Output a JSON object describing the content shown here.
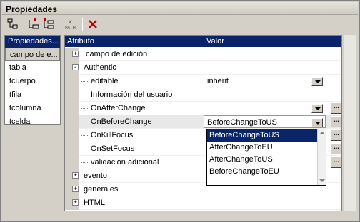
{
  "window": {
    "title": "Propiedades"
  },
  "left_panel": {
    "header": "Propiedades...",
    "items": [
      "campo de e...",
      "tabla",
      "tcuerpo",
      "tfila",
      "tcolumna",
      "tcelda"
    ],
    "selected": "campo de e..."
  },
  "grid": {
    "col_attribute": "Atributo",
    "col_value": "Valor",
    "rows": [
      {
        "name": "campo de edición",
        "expander": "+",
        "value": ""
      },
      {
        "name": "Authentic",
        "expander": "-",
        "value": ""
      },
      {
        "name": "editable",
        "value": "inherit"
      },
      {
        "name": "Información del usuario",
        "value": ""
      },
      {
        "name": "OnAfterChange",
        "value": ""
      },
      {
        "name": "OnBeforeChange",
        "value": "BeforeChangeToUS"
      },
      {
        "name": "OnKillFocus",
        "value": ""
      },
      {
        "name": "OnSetFocus",
        "value": ""
      },
      {
        "name": "validación adicional",
        "value": ""
      },
      {
        "name": "evento",
        "expander": "+",
        "value": ""
      },
      {
        "name": "generales",
        "expander": "+",
        "value": ""
      },
      {
        "name": "HTML",
        "expander": "+",
        "value": ""
      }
    ]
  },
  "dropdown": {
    "options": [
      "BeforeChangeToUS",
      "AfterChangeToEU",
      "AfterChangeToUS",
      "BeforeChangeToEU"
    ],
    "selected": "BeforeChangeToUS"
  },
  "ellipsis_label": "...",
  "toolbar": {
    "path_label": "PATH"
  },
  "colors": {
    "selection": "#0a246a",
    "chrome": "#d4d0c8",
    "close_red": "#c00000"
  }
}
